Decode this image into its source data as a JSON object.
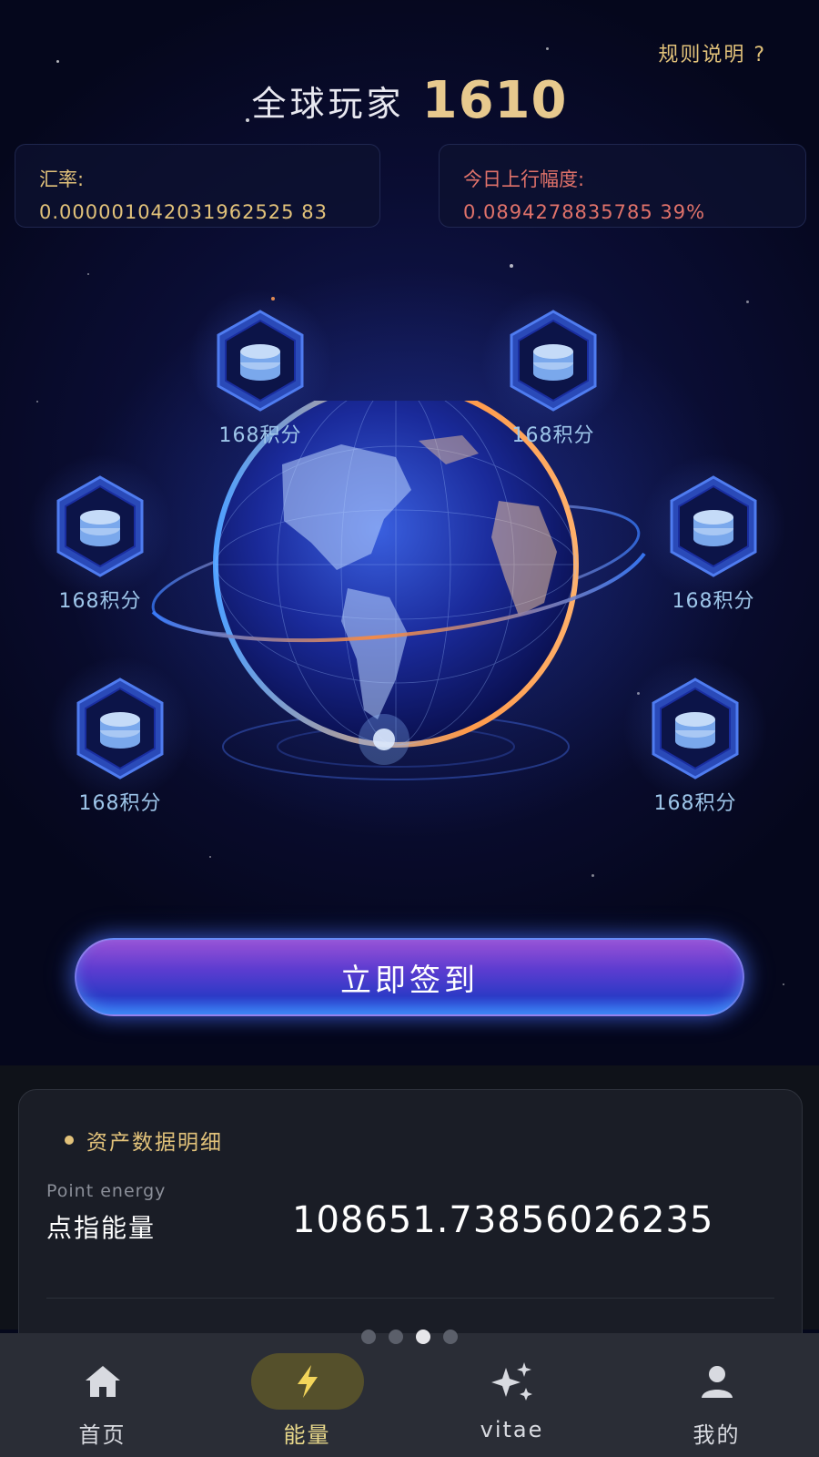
{
  "header": {
    "rules_link": "规则说明 ?",
    "players_label": "全球玩家",
    "players_count": "1610"
  },
  "stats": {
    "rate_label": "汇率:",
    "rate_value": "0.000001042031962525 83",
    "change_label": "今日上行幅度:",
    "change_value": "0.0894278835785 39%"
  },
  "rewards": [
    {
      "label": "168积分",
      "icon": "coin-stack-icon"
    },
    {
      "label": "168积分",
      "icon": "coin-stack-icon"
    },
    {
      "label": "168积分",
      "icon": "coin-stack-icon"
    },
    {
      "label": "168积分",
      "icon": "coin-stack-icon"
    },
    {
      "label": "168积分",
      "icon": "coin-stack-icon"
    },
    {
      "label": "168积分",
      "icon": "coin-stack-icon"
    }
  ],
  "checkin_button": "立即签到",
  "assets": {
    "title": "资产数据明细",
    "energy_en": "Point energy",
    "energy_cn": "点指能量",
    "energy_value": "108651.73856026235"
  },
  "pagination": {
    "total": 4,
    "active": 3
  },
  "tabbar": [
    {
      "label": "首页",
      "icon": "home-icon"
    },
    {
      "label": "能量",
      "icon": "lightning-icon",
      "active": true
    },
    {
      "label": "vitae",
      "icon": "sparkle-icon"
    },
    {
      "label": "我的",
      "icon": "user-icon"
    }
  ],
  "colors": {
    "gold": "#e2c27a",
    "red": "#e0726a",
    "active_tab_bg": "#55502b",
    "checkin_gradient_top": "#9a52d6",
    "checkin_gradient_bottom": "#2e6ef0"
  }
}
